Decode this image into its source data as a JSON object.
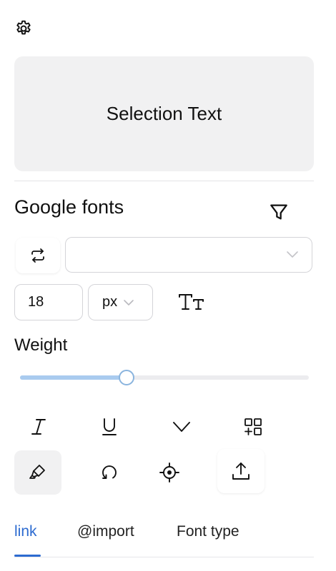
{
  "preview": {
    "text": "Selection Text"
  },
  "fonts": {
    "title": "Google fonts",
    "selected_font": ""
  },
  "size": {
    "value": "18",
    "unit": "px"
  },
  "weight": {
    "label": "Weight",
    "level_fraction": 0.37
  },
  "icons": {
    "settings": "gear-icon",
    "filter": "funnel-icon",
    "swap": "swap-arrows-icon",
    "text_size": "text-size-icon",
    "italic": "italic-icon",
    "underline": "underline-icon",
    "expand": "chevron-down-icon",
    "add_widget": "add-widget-icon",
    "highlight": "highlighter-icon",
    "reset": "reset-icon",
    "target": "crosshair-icon",
    "export": "export-icon"
  },
  "tabs": [
    {
      "label": "link",
      "active": true
    },
    {
      "label": "@import",
      "active": false
    },
    {
      "label": "Font type",
      "active": false
    }
  ],
  "colors": {
    "accent": "#2d6bd0",
    "slider_fill": "#a9cbef",
    "panel_bg": "#f1f1f2"
  }
}
